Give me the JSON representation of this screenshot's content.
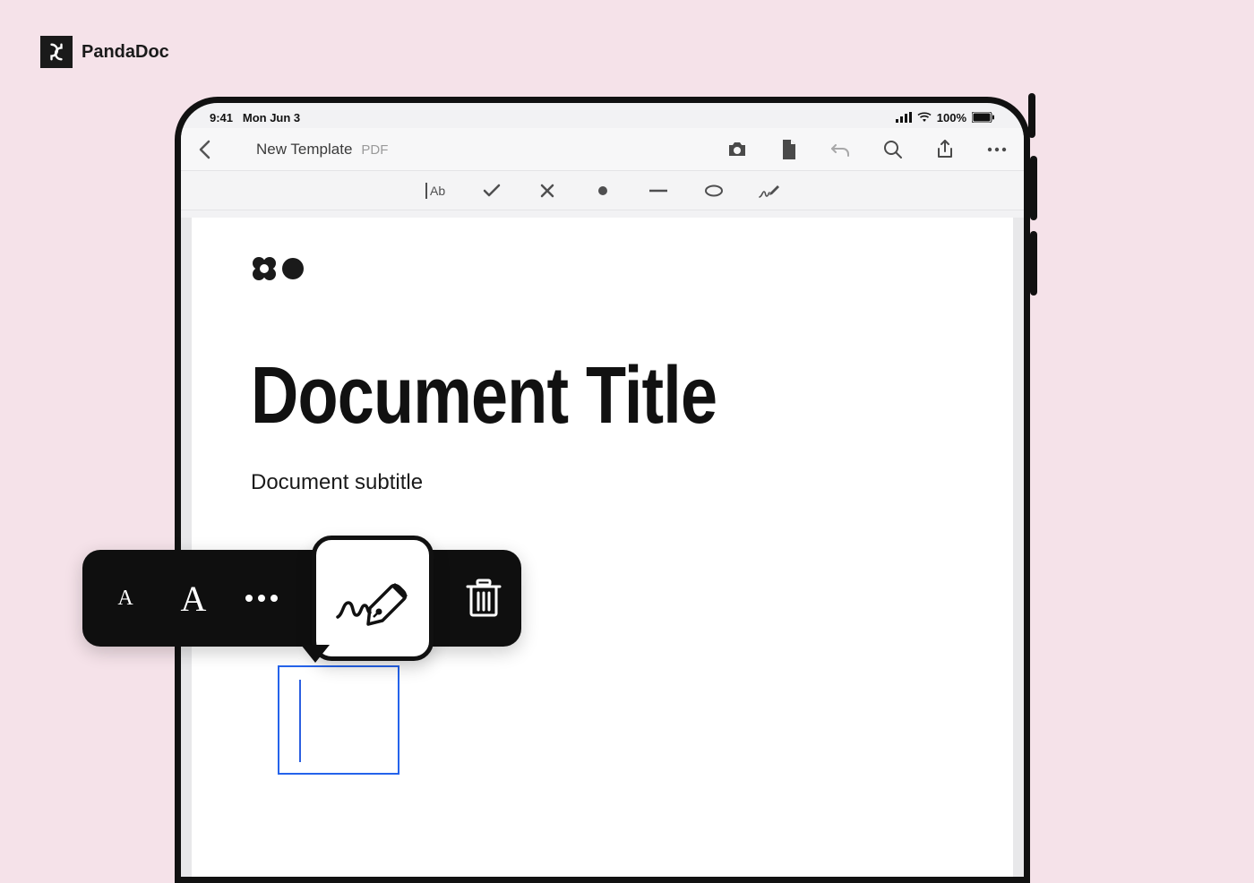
{
  "brand": {
    "name": "PandaDoc"
  },
  "statusbar": {
    "time": "9:41",
    "date": "Mon Jun 3",
    "battery": "100%"
  },
  "navbar": {
    "title": "New Template",
    "subtitle": "PDF",
    "icons": {
      "back": "chevron-left",
      "camera": "camera",
      "document": "document",
      "undo": "undo",
      "search": "search",
      "share": "share",
      "more": "more"
    }
  },
  "fieldbar": {
    "items": [
      "text-field",
      "check",
      "x",
      "dot",
      "line",
      "oval",
      "signature"
    ]
  },
  "document": {
    "title": "Document Title",
    "subtitle": "Document subtitle"
  },
  "context_toolbar": {
    "items": [
      "font-size-small",
      "font-size-large",
      "more",
      "signature",
      "delete"
    ],
    "active": "signature"
  }
}
